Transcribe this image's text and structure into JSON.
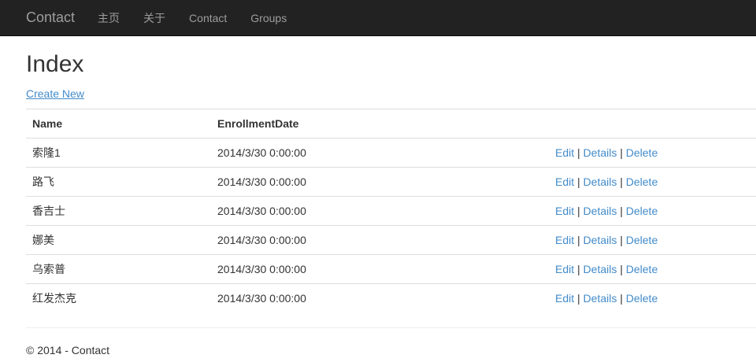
{
  "navbar": {
    "brand": "Contact",
    "links": [
      "主页",
      "关于",
      "Contact",
      "Groups"
    ]
  },
  "page": {
    "title": "Index",
    "create_link": "Create New"
  },
  "table": {
    "headers": [
      "Name",
      "EnrollmentDate"
    ],
    "rows": [
      {
        "name": "索隆1",
        "date": "2014/3/30 0:00:00"
      },
      {
        "name": "路飞",
        "date": "2014/3/30 0:00:00"
      },
      {
        "name": "香吉士",
        "date": "2014/3/30 0:00:00"
      },
      {
        "name": "娜美",
        "date": "2014/3/30 0:00:00"
      },
      {
        "name": "乌索普",
        "date": "2014/3/30 0:00:00"
      },
      {
        "name": "红发杰克",
        "date": "2014/3/30 0:00:00"
      }
    ],
    "actions": {
      "edit": "Edit",
      "details": "Details",
      "delete": "Delete",
      "separator": "|"
    }
  },
  "footer": {
    "text": "© 2014 - Contact"
  },
  "colors": {
    "navbar_bg": "#222222",
    "nav_text": "#9d9d9d",
    "link": "#428bca"
  }
}
